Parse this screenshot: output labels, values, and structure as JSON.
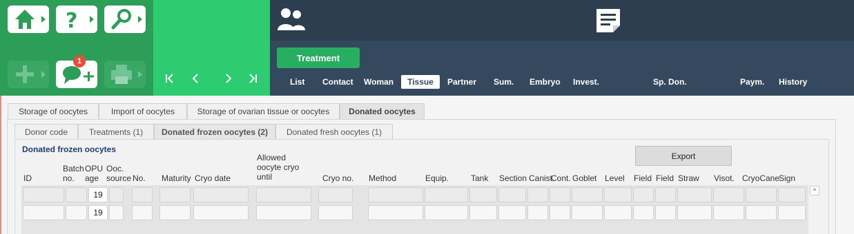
{
  "toolbar": {
    "notification_count": "1",
    "nav": {
      "first": "|<",
      "prev": "<",
      "next": ">",
      "last": ">|"
    }
  },
  "header": {
    "treatment_label": "Treatment",
    "tabs": [
      {
        "label": "List"
      },
      {
        "label": "Contact"
      },
      {
        "label": "Woman"
      },
      {
        "label": "Tissue",
        "active": true
      },
      {
        "label": "Partner"
      },
      {
        "label": "Sum."
      },
      {
        "label": "Embryo"
      },
      {
        "label": "Invest."
      },
      {
        "label": "Sp. Don."
      },
      {
        "label": "Paym."
      },
      {
        "label": "History"
      }
    ]
  },
  "tabs_level1": [
    {
      "label": "Storage of oocytes"
    },
    {
      "label": "Import of oocytes"
    },
    {
      "label": "Storage of ovarian tissue or oocytes"
    },
    {
      "label": "Donated oocytes",
      "active": true
    }
  ],
  "tabs_level2": [
    {
      "label": "Donor code"
    },
    {
      "label": "Treatments (1)"
    },
    {
      "label": "Donated frozen oocytes (2)",
      "active": true
    },
    {
      "label": "Donated fresh oocytes (1)"
    }
  ],
  "section_title": "Donated frozen oocytes",
  "export_label": "Export",
  "columns": [
    {
      "label": "ID"
    },
    {
      "label": "Batch\nno."
    },
    {
      "label": "OPU\nage"
    },
    {
      "label": "Ooc.\nsource"
    },
    {
      "label": "No."
    },
    {
      "label": "Maturity"
    },
    {
      "label": "Cryo date"
    },
    {
      "label": "Allowed\noocyte cryo\nuntil"
    },
    {
      "label": "Cryo no."
    },
    {
      "label": "Method"
    },
    {
      "label": "Equip."
    },
    {
      "label": "Tank"
    },
    {
      "label": "Section"
    },
    {
      "label": "Canist."
    },
    {
      "label": "Cont."
    },
    {
      "label": "Goblet"
    },
    {
      "label": "Level"
    },
    {
      "label": "Field"
    },
    {
      "label": "Field"
    },
    {
      "label": "Straw"
    },
    {
      "label": "Visot."
    },
    {
      "label": "CryoCane"
    },
    {
      "label": "Sign"
    }
  ],
  "rows": [
    {
      "opu_age": "19"
    },
    {
      "opu_age": "19"
    }
  ],
  "scroll_up": "^"
}
